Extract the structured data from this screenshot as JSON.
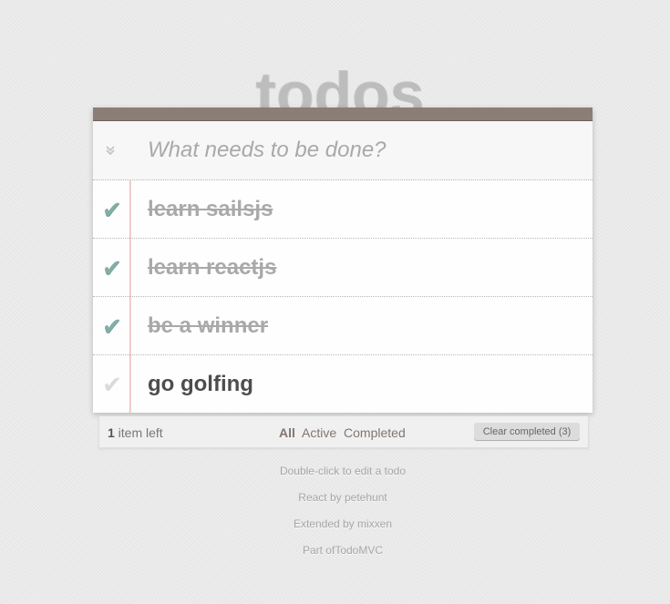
{
  "app": {
    "title": "todos"
  },
  "header": {
    "toggle_all_icon": "double-chevron-down",
    "new_todo_placeholder": "What needs to be done?",
    "new_todo_value": ""
  },
  "todos": [
    {
      "title": "learn sailsjs",
      "completed": true
    },
    {
      "title": "learn reactjs",
      "completed": true
    },
    {
      "title": "be a winner",
      "completed": true
    },
    {
      "title": "go golfing",
      "completed": false
    }
  ],
  "footer": {
    "count": "1",
    "count_suffix": " item left",
    "filters": [
      {
        "label": "All",
        "selected": true
      },
      {
        "label": "Active",
        "selected": false
      },
      {
        "label": "Completed",
        "selected": false
      }
    ],
    "clear_label": "Clear completed (3)"
  },
  "info": {
    "hint": "Double-click to edit a todo",
    "credit1": "React by petehunt",
    "credit2": "Extended by mixxen",
    "credit3": "Part ofTodoMVC"
  },
  "colors": {
    "topbar": "#8d7d77",
    "check_done": "#85ada7",
    "check_open": "#dadada",
    "margin_line": "#f0c0c0",
    "background": "#eaeaea"
  }
}
